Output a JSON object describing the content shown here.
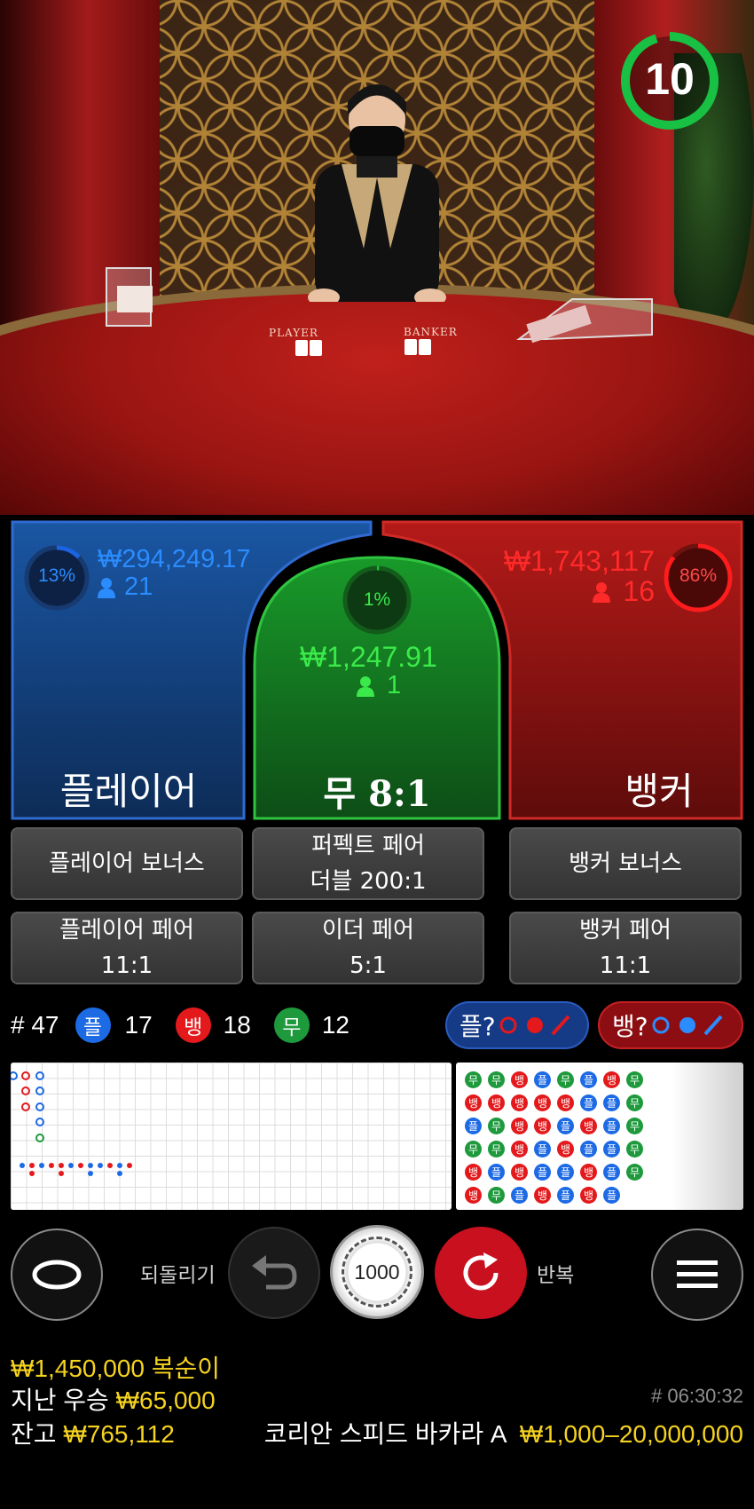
{
  "timer": {
    "value": "10",
    "ring_color": "#18c043",
    "fraction_remaining": 0.95
  },
  "table_labels": {
    "player": "PLAYER",
    "banker": "BANKER"
  },
  "player": {
    "label": "플레이어",
    "percent": "13%",
    "percent_value": 0.13,
    "amount": "₩294,249.17",
    "bettors": "21",
    "color": "#1b64e0"
  },
  "tie": {
    "label": "무 8:1",
    "percent": "1%",
    "percent_value": 0.01,
    "amount": "₩1,247.91",
    "bettors": "1",
    "color": "#19c52a"
  },
  "banker": {
    "label": "뱅커",
    "percent": "86%",
    "percent_value": 0.86,
    "amount": "₩1,743,117",
    "bettors": "16",
    "color": "#ff1c1c"
  },
  "side_bets": {
    "player_bonus": "플레이어 보너스",
    "perfect_pair_line1": "퍼펙트 페어",
    "perfect_pair_line2": "더블 200:1",
    "banker_bonus": "뱅커 보너스",
    "player_pair_line1": "플레이어 페어",
    "player_pair_line2": "11:1",
    "either_pair_line1": "이더 페어",
    "either_pair_line2": "5:1",
    "banker_pair_line1": "뱅커 페어",
    "banker_pair_line2": "11:1"
  },
  "stats": {
    "round": "# 47",
    "player_badge": "플",
    "player_count": "17",
    "banker_badge": "뱅",
    "banker_count": "18",
    "tie_badge": "무",
    "tie_count": "12",
    "player_ask": "플?",
    "banker_ask": "뱅?"
  },
  "bead_road": [
    [
      "무",
      "무",
      "뱅",
      "플",
      "무",
      "플",
      "뱅",
      "무"
    ],
    [
      "뱅",
      "뱅",
      "뱅",
      "뱅",
      "뱅",
      "플",
      "플",
      "무"
    ],
    [
      "플",
      "무",
      "뱅",
      "뱅",
      "플",
      "뱅",
      "플",
      "무"
    ],
    [
      "무",
      "무",
      "뱅",
      "플",
      "뱅",
      "플",
      "플",
      "무"
    ],
    [
      "뱅",
      "플",
      "뱅",
      "플",
      "플",
      "뱅",
      "플",
      "무"
    ],
    [
      "뱅",
      "무",
      "플",
      "뱅",
      "플",
      "뱅",
      "플",
      ""
    ]
  ],
  "colors": {
    "player": "#1d6ae5",
    "banker": "#e3191c",
    "tie": "#1e9a3d",
    "gold": "#f6d31f",
    "undo_bg": "#1a1a1a",
    "repeat_bg": "#c8101e"
  },
  "controls": {
    "undo_label": "되돌리기",
    "chip_value": "1000",
    "repeat_label": "반복"
  },
  "footer": {
    "last_win_name_line": "₩1,450,000 복순이",
    "last_win_prefix": "지난 우승",
    "last_win_amount": "₩65,000",
    "game_id": "# 06:30:32",
    "balance_label": "잔고",
    "balance_value": "₩765,112",
    "table_name": "코리안 스피드 바카라 A",
    "limits": "₩1,000–20,000,000"
  }
}
